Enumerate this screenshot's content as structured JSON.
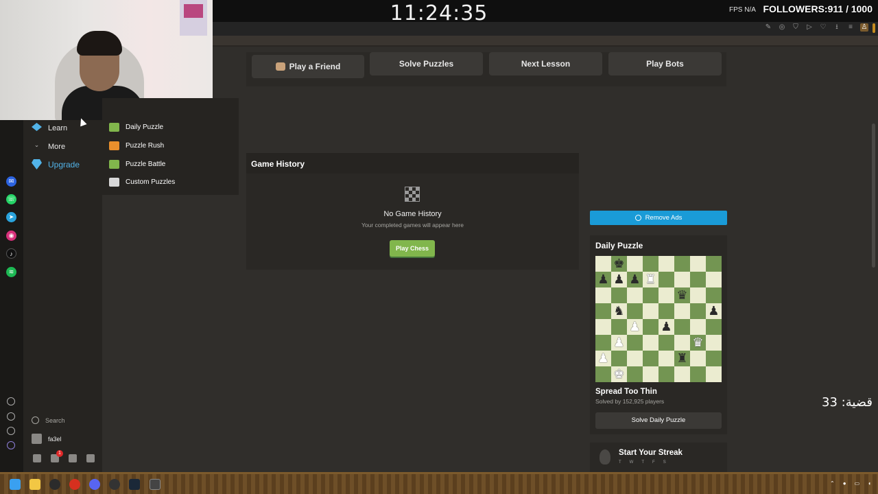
{
  "overlay": {
    "clock": "11:24:35",
    "fps_label": "FPS",
    "fps_value": "N/A",
    "followers": "FOLLOWERS:911 / 1000",
    "arabic_counter": "قضية: 33"
  },
  "nav": {
    "items": [
      {
        "label": "Learn"
      },
      {
        "label": "More"
      },
      {
        "label": "Upgrade"
      }
    ],
    "search_label": "Search",
    "username": "fa3el",
    "notification_count": "1"
  },
  "flyout": {
    "items": [
      {
        "label": "Daily Puzzle",
        "color": "#81b64c"
      },
      {
        "label": "Puzzle Rush",
        "color": "#e98f2c"
      },
      {
        "label": "Puzzle Battle",
        "color": "#81b64c"
      },
      {
        "label": "Custom Puzzles",
        "color": "#d8d8d8"
      }
    ]
  },
  "quick_actions": [
    {
      "label": "Play a Friend"
    },
    {
      "label": "Solve Puzzles"
    },
    {
      "label": "Next Lesson"
    },
    {
      "label": "Play Bots"
    }
  ],
  "game_history": {
    "title": "Game History",
    "empty_title": "No Game History",
    "empty_sub": "Your completed games will appear here",
    "button": "Play Chess"
  },
  "ads": {
    "remove_label": "Remove Ads"
  },
  "daily_puzzle": {
    "title": "Daily Puzzle",
    "name": "Spread Too Thin",
    "solved": "Solved by 152,925 players",
    "button": "Solve Daily Puzzle",
    "board": [
      [
        "",
        "bk",
        "",
        "",
        "",
        "",
        "",
        ""
      ],
      [
        "bp",
        "bp",
        "bp",
        "wr",
        "",
        "",
        "",
        ""
      ],
      [
        "",
        "",
        "",
        "",
        "",
        "bq",
        "",
        ""
      ],
      [
        "",
        "bn",
        "",
        "",
        "",
        "",
        "",
        "bp"
      ],
      [
        "",
        "",
        "wp",
        "",
        "bp",
        "",
        "",
        ""
      ],
      [
        "",
        "wp",
        "",
        "",
        "",
        "",
        "wq",
        ""
      ],
      [
        "wp",
        "",
        "",
        "",
        "",
        "br",
        "",
        ""
      ],
      [
        "",
        "wk",
        "",
        "",
        "",
        "",
        "",
        ""
      ]
    ]
  },
  "streak": {
    "title": "Start Your Streak",
    "days": [
      "T",
      "W",
      "T",
      "F",
      "S"
    ]
  },
  "colors": {
    "accent_green": "#81b64c",
    "ads_blue": "#1a9bd7",
    "upgrade_blue": "#52b3e8",
    "board_light": "#ebecd0",
    "board_dark": "#739552"
  }
}
